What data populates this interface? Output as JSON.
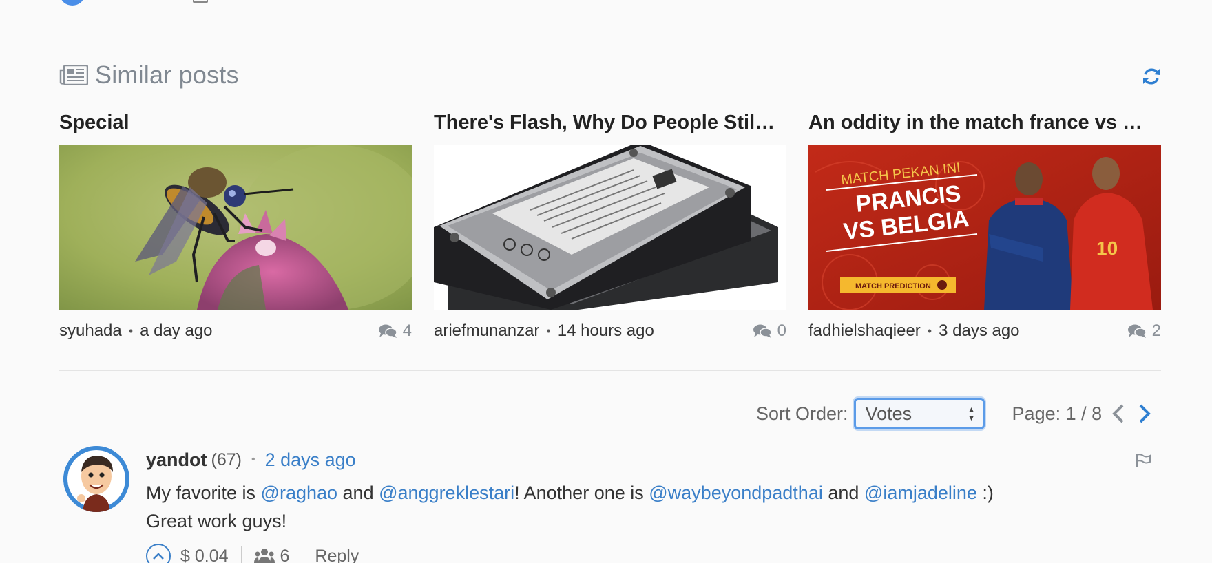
{
  "header": {
    "title": "Similar posts",
    "newspaper_icon": "newspaper-icon",
    "refresh_icon": "refresh-icon"
  },
  "similar_posts": [
    {
      "title": "Special",
      "author": "syuhada",
      "time": "a day ago",
      "comments": "4",
      "image": "insect-on-flower"
    },
    {
      "title": "There's Flash, Why Do People Stil…",
      "author": "ariefmunanzar",
      "time": "14 hours ago",
      "comments": "0",
      "image": "hard-disk-drives"
    },
    {
      "title": "An oddity in the match france vs …",
      "author": "fadhielshaqieer",
      "time": "3 days ago",
      "comments": "2",
      "image": "football-banner",
      "banner": {
        "line1": "MATCH PEKAN INI",
        "line2": "PRANCIS",
        "line3": "VS BELGIA",
        "button": "MATCH PREDICTION",
        "jersey_number": "10"
      }
    }
  ],
  "sort": {
    "label": "Sort Order:",
    "selected": "Votes",
    "page_label": "Page: 1 / 8"
  },
  "comment": {
    "author": "yandot",
    "reputation": "(67)",
    "time": "2 days ago",
    "text_parts": [
      "My favorite is ",
      "@raghao",
      " and ",
      "@anggreklestari",
      "! Another one is ",
      "@waybeyondpadthai",
      " and ",
      "@iamjadeline",
      " :)"
    ],
    "text_line2": "Great work guys!",
    "payout": "$ 0.04",
    "voters": "6",
    "reply_label": "Reply"
  },
  "colors": {
    "accent": "#3a7fc8",
    "muted": "#808891",
    "focus_ring": "#5b9be8"
  }
}
